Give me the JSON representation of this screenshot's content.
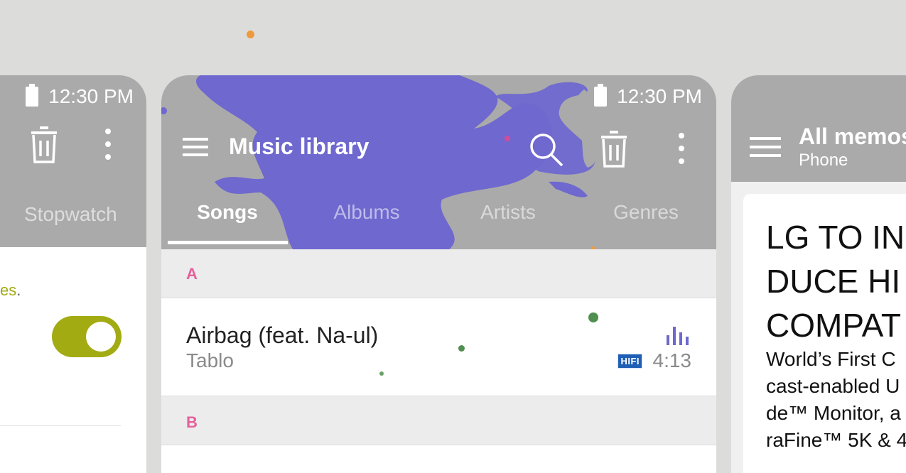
{
  "left_card": {
    "status_time": "12:30 PM",
    "tab_label": "Stopwatch",
    "partial_text": "es",
    "toggle_on": true,
    "accent_color": "#a2ab12"
  },
  "middle_card": {
    "status_time": "12:30 PM",
    "title": "Music library",
    "tabs": [
      {
        "label": "Songs",
        "active": true
      },
      {
        "label": "Albums",
        "active": false
      },
      {
        "label": "Artists",
        "active": false
      },
      {
        "label": "Genres",
        "active": false
      }
    ],
    "sections": [
      {
        "letter": "A",
        "songs": [
          {
            "title": "Airbag (feat. Na-ul)",
            "artist": "Tablo",
            "badge": "HIFI",
            "duration": "4:13"
          }
        ]
      },
      {
        "letter": "B",
        "songs": []
      }
    ],
    "splash_color": "#6e68cf",
    "section_letter_color": "#e5609a",
    "badge_color": "#1e5fb5"
  },
  "right_card": {
    "title": "All memos",
    "subtitle": "Phone",
    "memo_headline": [
      "LG TO IN",
      "DUCE HI",
      "COMPAT"
    ],
    "memo_body": [
      "World’s First C",
      "cast-enabled U",
      "de™ Monitor, a",
      "raFine™ 5K & 4"
    ]
  }
}
